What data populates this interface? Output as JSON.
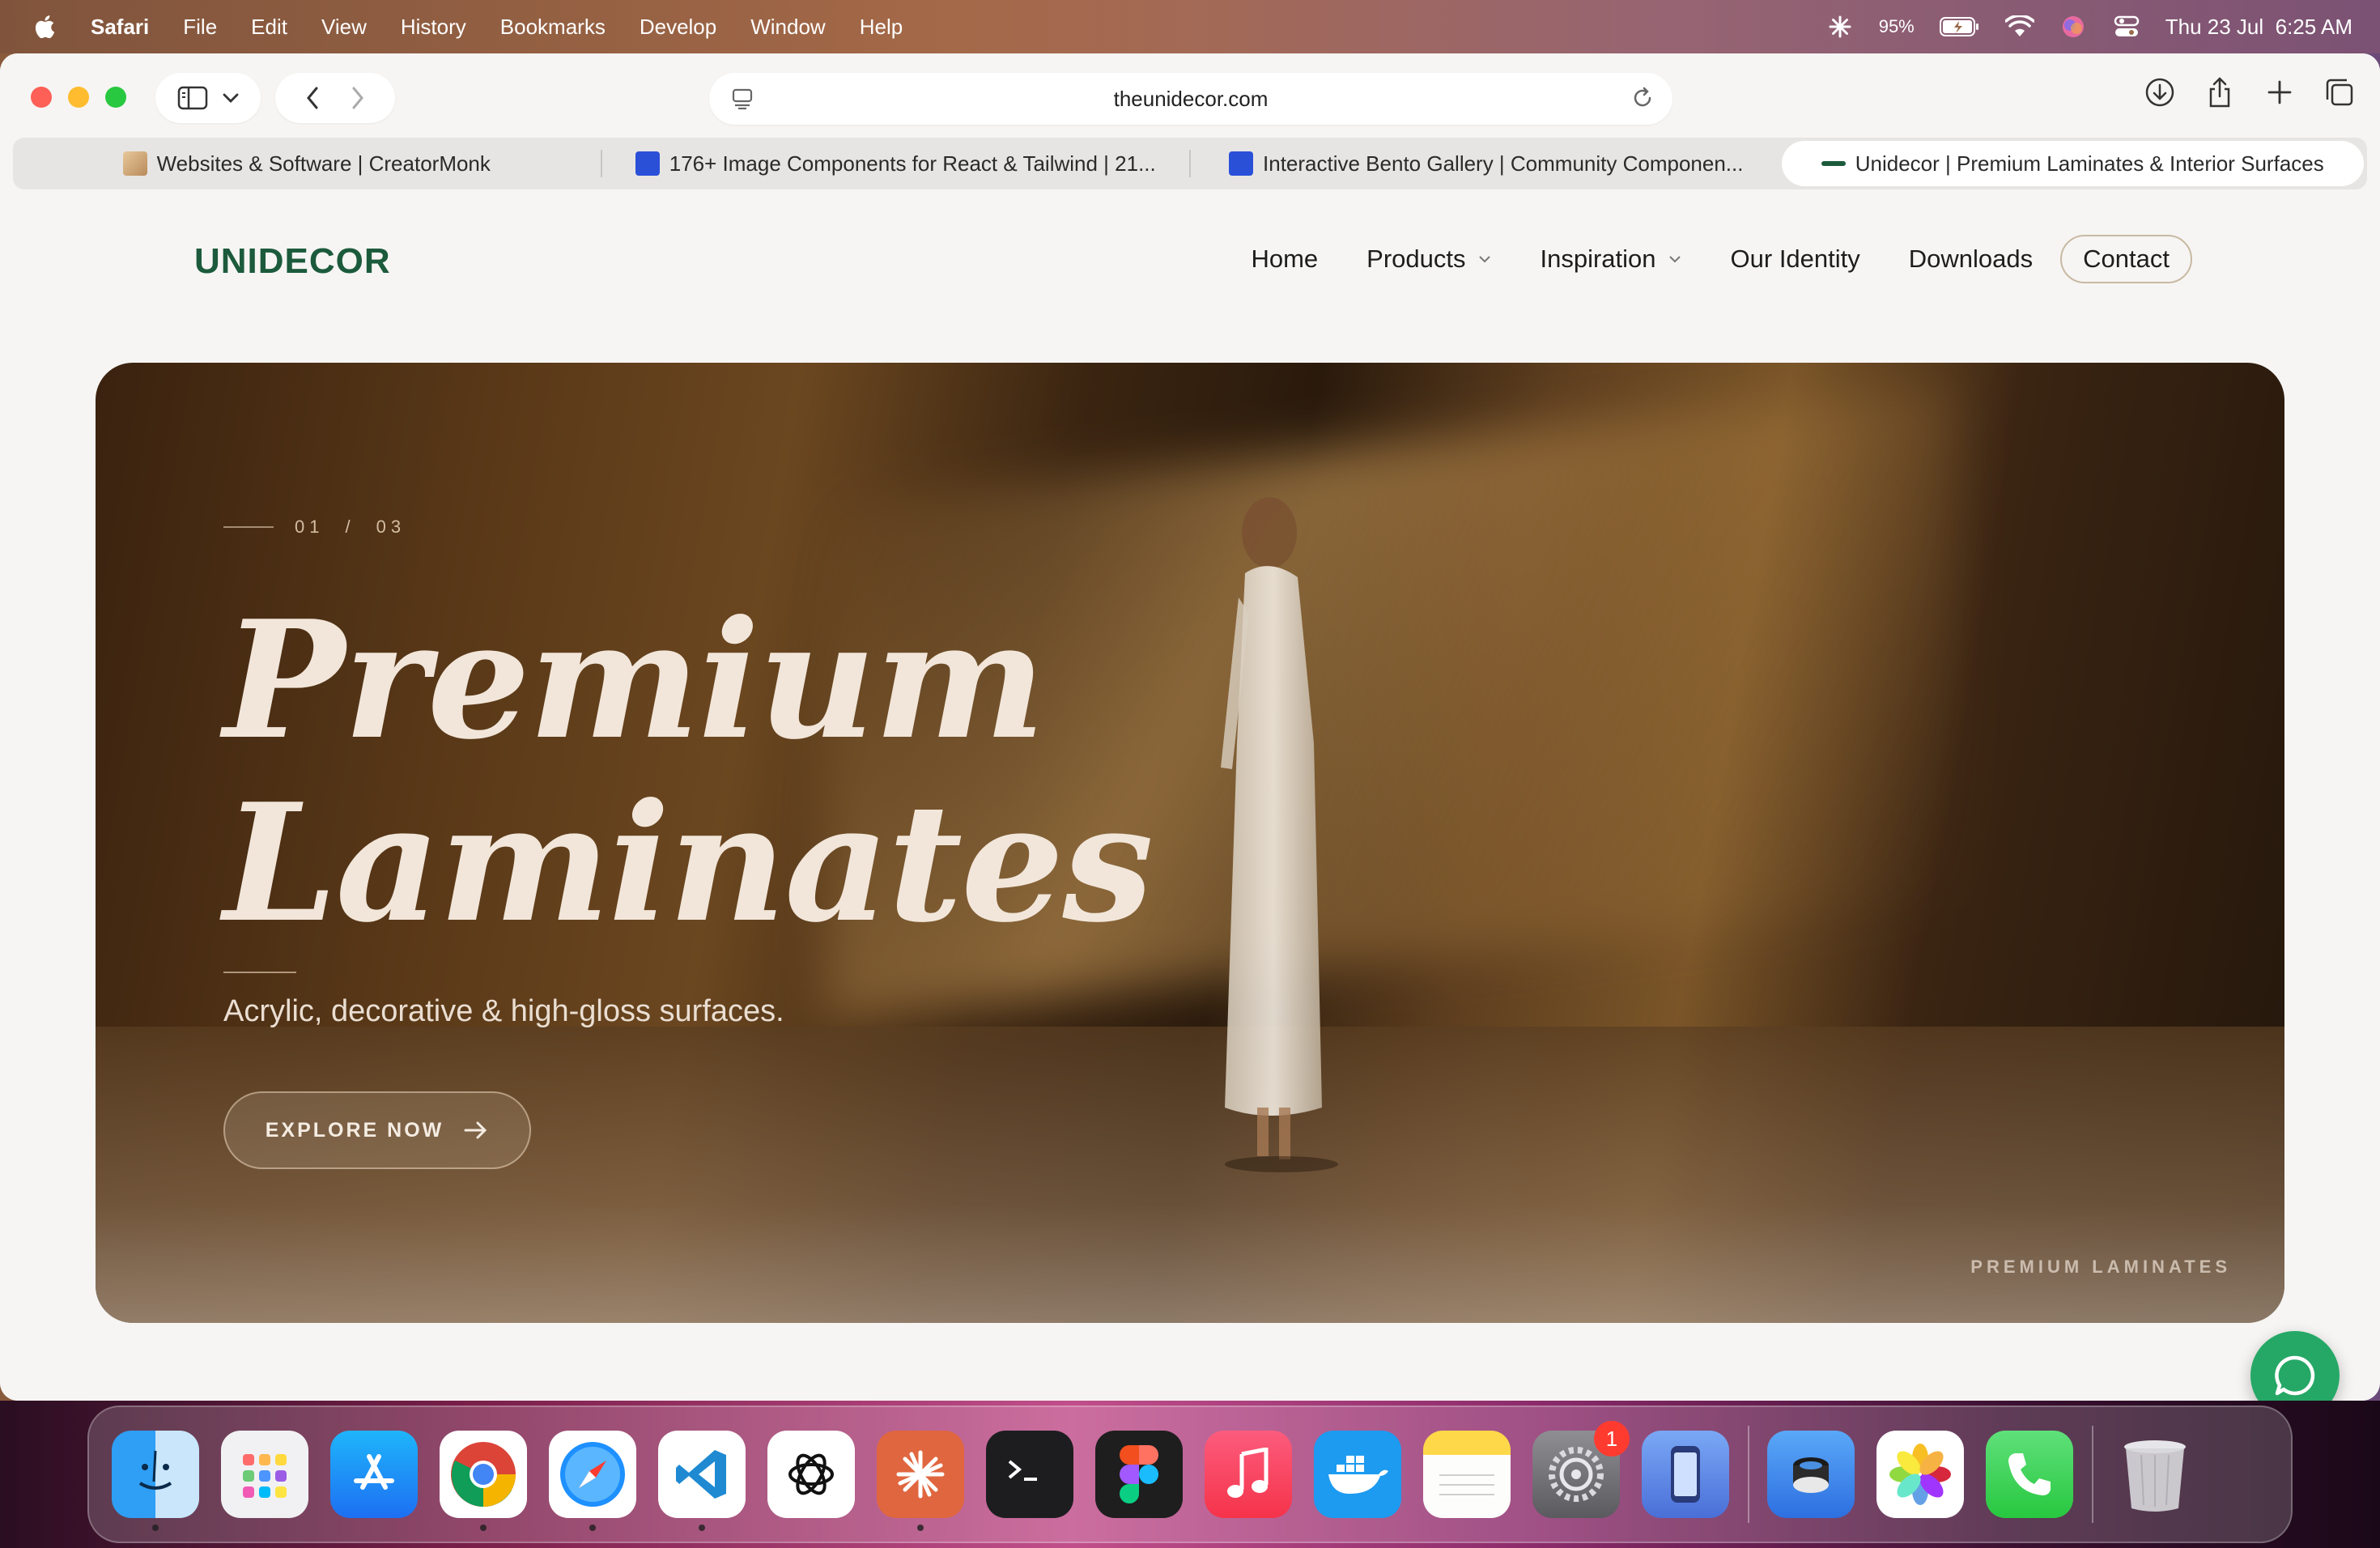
{
  "menubar": {
    "app_name": "Safari",
    "items": [
      "File",
      "Edit",
      "View",
      "History",
      "Bookmarks",
      "Develop",
      "Window",
      "Help"
    ],
    "battery": "95%",
    "datetime": "Thu 23 Jul  6:25 AM"
  },
  "browser": {
    "url": "theunidecor.com",
    "tabs": [
      {
        "label": "Websites & Software | CreatorMonk",
        "active": false
      },
      {
        "label": "176+ Image Components for React & Tailwind | 21...",
        "active": false
      },
      {
        "label": "Interactive Bento Gallery | Community Componen...",
        "active": false
      },
      {
        "label": "Unidecor | Premium Laminates & Interior Surfaces",
        "active": true
      }
    ]
  },
  "site": {
    "logo": "UNIDECOR",
    "nav": {
      "home": "Home",
      "products": "Products",
      "inspiration": "Inspiration",
      "identity": "Our Identity",
      "downloads": "Downloads",
      "contact": "Contact"
    },
    "hero": {
      "counter_current": "01",
      "counter_sep": "/",
      "counter_total": "03",
      "title_line1": "Premium",
      "title_line2": "Laminates",
      "subtitle": "Acrylic, decorative & high-gloss surfaces.",
      "cta": "EXPLORE NOW",
      "caption": "PREMIUM LAMINATES"
    }
  },
  "dock": {
    "apps": [
      "finder-icon",
      "launchpad-icon",
      "app-store-icon",
      "chrome-icon",
      "safari-icon",
      "vscode-icon",
      "chatgpt-icon",
      "claude-icon",
      "terminal-icon",
      "figma-icon",
      "music-icon",
      "docker-icon",
      "notes-icon",
      "system-settings-icon",
      "simulator-icon",
      "preview-icon",
      "photos-icon",
      "phone-icon",
      "trash-icon"
    ],
    "settings_badge": "1"
  },
  "colors": {
    "brand_green": "#1c5a3c",
    "chat_green": "#25a866",
    "contact_border": "#c9b9a3"
  }
}
